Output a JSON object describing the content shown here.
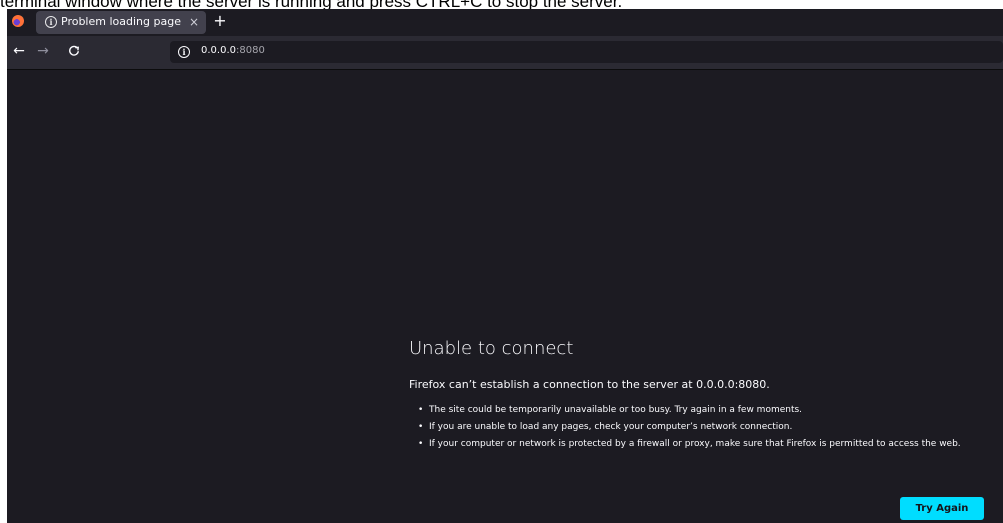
{
  "caption": "terminal window where the server is running and press CTRL+C to stop the server.",
  "browser": {
    "tab": {
      "title": "Problem loading page",
      "close_glyph": "×",
      "info_icon": "info-icon"
    },
    "new_tab_glyph": "+",
    "nav": {
      "back_glyph": "←",
      "forward_glyph": "→",
      "reload_glyph": "C"
    },
    "url": {
      "host": "0.0.0.0",
      "port": ":8080"
    }
  },
  "error": {
    "title": "Unable to connect",
    "description": "Firefox can’t establish a connection to the server at 0.0.0.0:8080.",
    "bullets": [
      "The site could be temporarily unavailable or too busy. Try again in a few moments.",
      "If you are unable to load any pages, check your computer’s network connection.",
      "If your computer or network is protected by a firewall or proxy, make sure that Firefox is permitted to access the web."
    ],
    "button_label": "Try Again"
  },
  "colors": {
    "background": "#1c1b22",
    "toolbar": "#2b2a33",
    "tab_active": "#42414d",
    "accent_button": "#00ddff"
  }
}
